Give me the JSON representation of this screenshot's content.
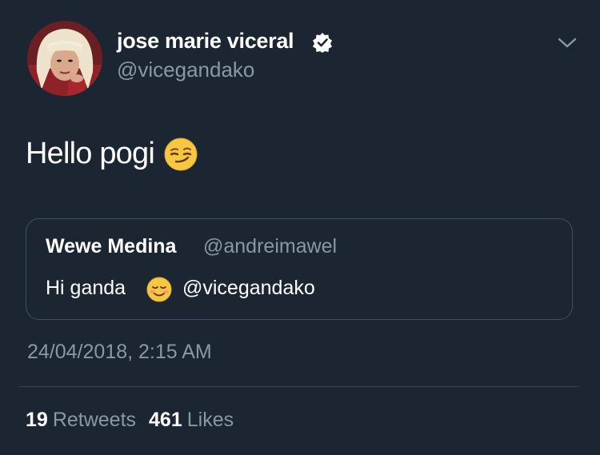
{
  "tweet": {
    "author": {
      "name": "jose marie viceral",
      "handle": "@vicegandako",
      "verified": true,
      "avatar_icon": "profile-photo"
    },
    "text": "Hello pogi",
    "emoji": "smirking-face",
    "quoted": {
      "name": "Wewe Medina",
      "handle": "@andreimawel",
      "text": "Hi ganda",
      "emoji": "smiling-face",
      "mention": "@vicegandako"
    },
    "timestamp": "24/04/2018, 2:15 AM",
    "stats": {
      "retweets_count": "19",
      "retweets_label": "Retweets",
      "likes_count": "461",
      "likes_label": "Likes"
    }
  },
  "colors": {
    "background": "#1c2633",
    "secondary_text": "#8899a6",
    "border": "#3e5063",
    "divider": "#38444d"
  }
}
